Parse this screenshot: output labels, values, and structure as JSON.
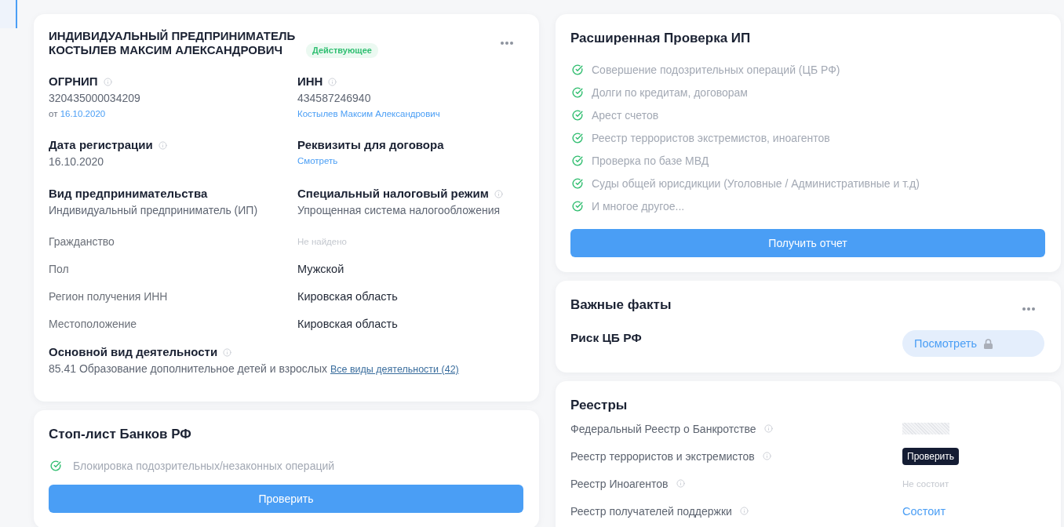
{
  "company": {
    "title": "ИНДИВИДУАЛЬНЫЙ ПРЕДПРИНИМАТЕЛЬ КОСТЫЛЕВ МАКСИМ АЛЕКСАНДРОВИЧ",
    "status": {
      "text": "Действующее",
      "kind": "active"
    },
    "details": [
      {
        "label": "ОГРНИП",
        "info": true,
        "value": "320435000034209",
        "note": {
          "prefix": "от",
          "link": "16.10.2020"
        }
      },
      {
        "label": "ИНН",
        "info": true,
        "value": "434587246940",
        "note": {
          "link": "Костылев Максим Александрович"
        }
      },
      {
        "label": "Дата регистрации",
        "info": true,
        "value": "16.10.2020"
      },
      {
        "label": "Реквизиты для договора",
        "info": false,
        "note": {
          "link": "Смотреть"
        }
      },
      {
        "label": "Вид предпринимательства",
        "info": false,
        "value": "Индивидуальный предприниматель (ИП)"
      },
      {
        "label": "Специальный налоговый режим",
        "info": true,
        "value": "Упрощенная система налогообложения"
      }
    ],
    "attributes": [
      {
        "label": "Гражданство",
        "value": "Не найдено",
        "found": false
      },
      {
        "label": "Пол",
        "value": "Мужской",
        "found": true
      },
      {
        "label": "Регион получения ИНН",
        "value": "Кировская область",
        "found": true
      },
      {
        "label": "Местоположение",
        "value": "Кировская область",
        "found": true
      }
    ],
    "activity": {
      "label": "Основной вид деятельности",
      "info": true,
      "value": "85.41 Образование дополнительное детей и взрослых",
      "link": "Все виды деятельности (42)"
    }
  },
  "stop_list": {
    "title": "Стоп-лист Банков РФ",
    "items": [
      {
        "text": "Блокировка подозрительных/незаконных операций",
        "checked": true
      }
    ],
    "button": "Проверить"
  },
  "extended_check": {
    "title": "Расширенная Проверка ИП",
    "items": [
      {
        "text": "Совершение подозрительных операций (ЦБ РФ)",
        "checked": true
      },
      {
        "text": "Долги по кредитам, договорам",
        "checked": true
      },
      {
        "text": "Арест счетов",
        "checked": true
      },
      {
        "text": "Реестр террористов экстремистов, иноагентов",
        "checked": true
      },
      {
        "text": "Проверка по базе МВД",
        "checked": true
      },
      {
        "text": "Суды общей юрисдикции (Уголовные / Административные и т.д)",
        "checked": true
      },
      {
        "text": "И многое другое...",
        "checked": true
      }
    ],
    "button": "Получить отчет"
  },
  "important_facts": {
    "title": "Важные факты",
    "facts": [
      {
        "label": "Риск ЦБ РФ",
        "button": "Посмотреть",
        "locked": true
      }
    ]
  },
  "registries": {
    "title": "Реестры",
    "rows": [
      {
        "label": "Федеральный Реестр о Банкротстве",
        "info": true,
        "kind": "hidden"
      },
      {
        "label": "Реестр террористов и экстремистов",
        "info": true,
        "kind": "button",
        "value": "Проверить"
      },
      {
        "label": "Реестр Иноагентов",
        "info": true,
        "kind": "muted",
        "value": "Не состоит"
      },
      {
        "label": "Реестр получателей поддержки",
        "info": true,
        "kind": "link",
        "value": "Состоит"
      }
    ]
  }
}
